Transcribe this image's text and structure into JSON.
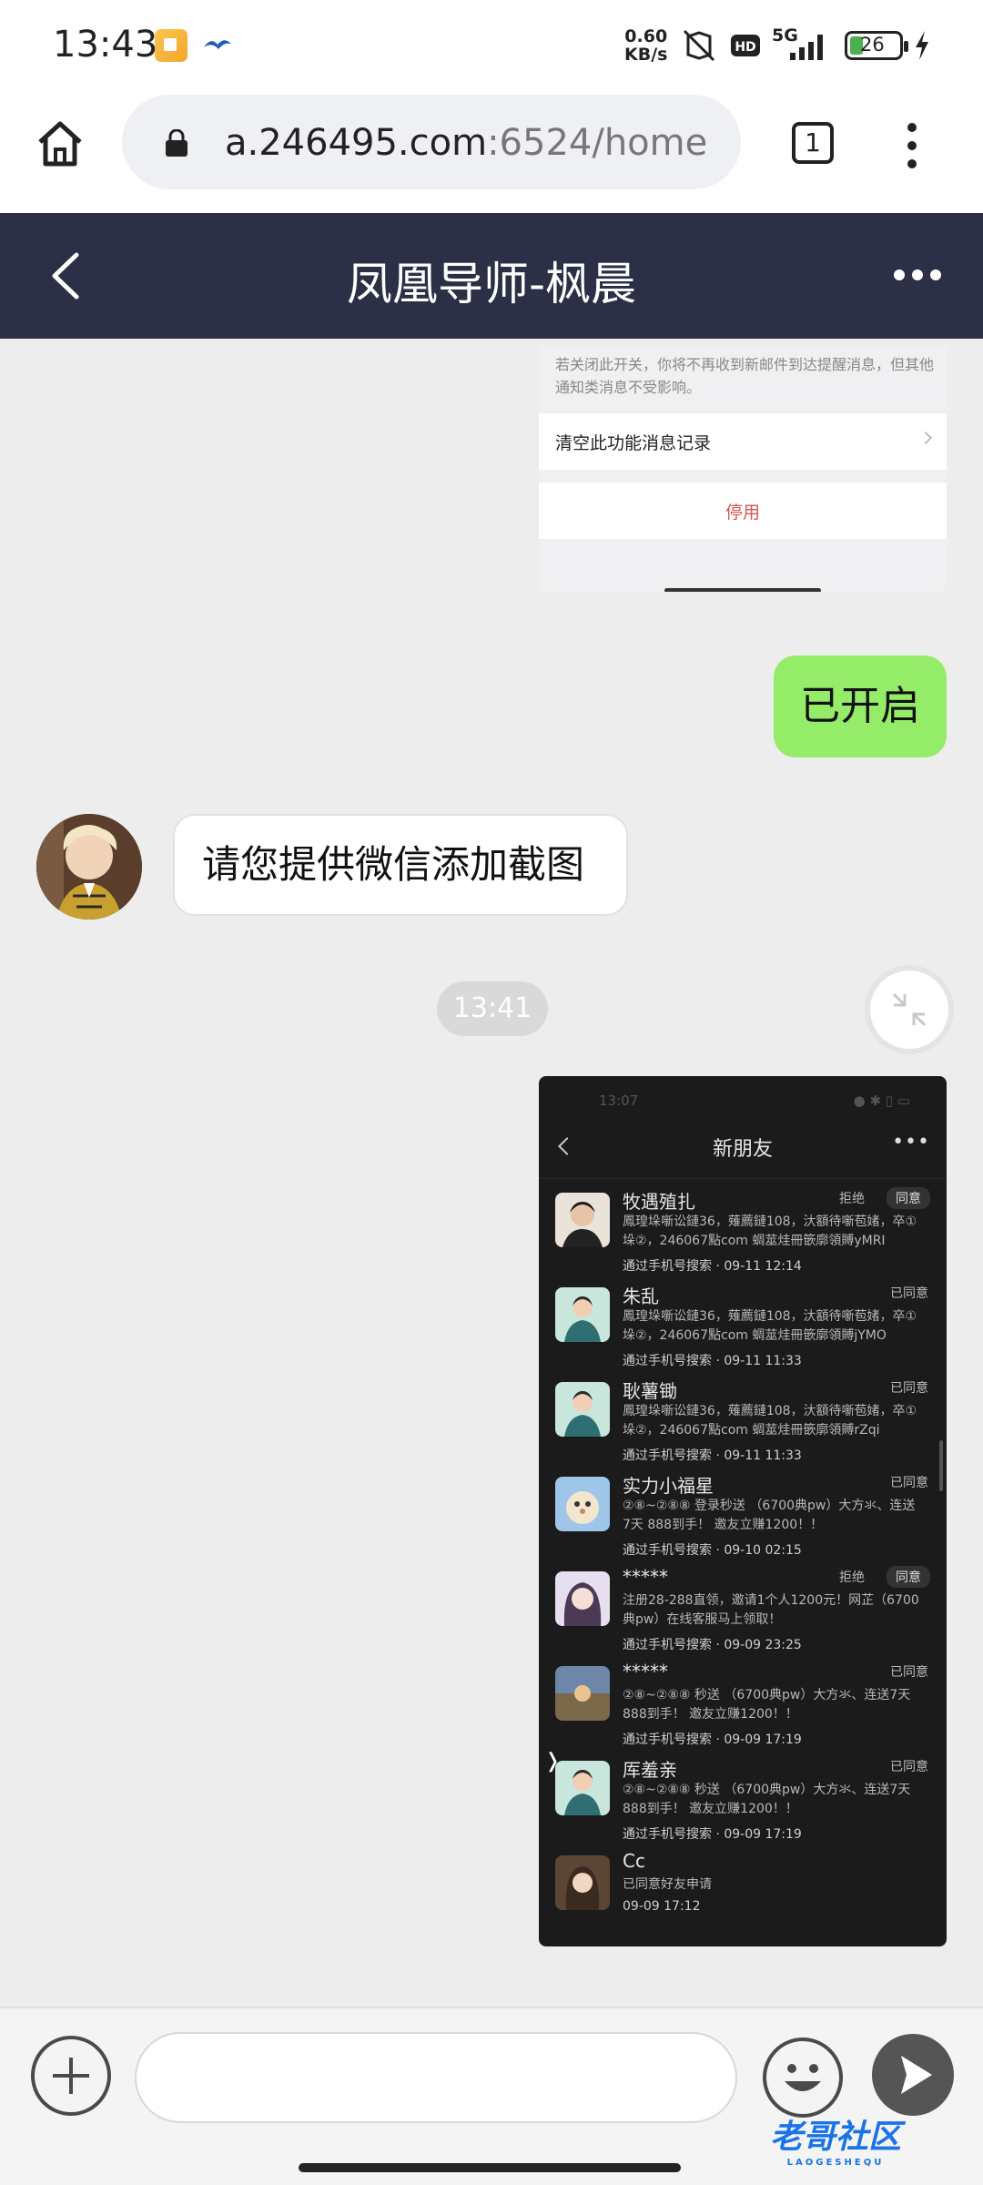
{
  "status_bar": {
    "time": "13:43",
    "net_speed_value": "0.60",
    "net_speed_unit": "KB/s",
    "hd": "HD",
    "network": "5G",
    "battery": "26",
    "battery_level": 26
  },
  "browser": {
    "url_host": "a.246495.com",
    "url_rest": ":6524/home",
    "tab_count": "1"
  },
  "chat": {
    "title": "凤凰导师-枫晨",
    "screenshot1": {
      "note": "若关闭此开关，你将不再收到新邮件到达提醒消息，但其他通知类消息不受影响。",
      "row_label": "清空此功能消息记录",
      "disable_label": "停用"
    },
    "outgoing_text": "已开启",
    "incoming_text": "请您提供微信添加截图",
    "time_divider": "13:41",
    "screenshot2": {
      "status_time": "13:07",
      "title": "新朋友",
      "more": "•••",
      "friends": [
        {
          "name": "牧遇殖扎",
          "msg": "鳳瑝垛噺讼鏈36，薙薦鏈108，汏額待噺苞媎，卒①垛②，246067點com 蜩莁烓冊篏廓領賻yMRI",
          "source": "通过手机号搜索 · 09-11 12:14",
          "reject": "拒绝",
          "action": "同意"
        },
        {
          "name": "朱乱",
          "msg": "鳳瑝垛噺讼鏈36，薙薦鏈108，汏額待噺苞媎，卒①垛②，246067點com 蜩莁烓冊篏廓領賻jYMO",
          "source": "通过手机号搜索 · 09-11 11:33",
          "status": "已同意"
        },
        {
          "name": "耿薯锄",
          "msg": "鳳瑝垛噺讼鏈36，薙薦鏈108，汏額待噺苞媎，卒①垛②，246067點com 蜩莁烓冊篏廓領賻rZqi",
          "source": "通过手机号搜索 · 09-11 11:33",
          "status": "已同意"
        },
        {
          "name": "实力小福星",
          "msg": "②⑧~②⑧⑧ 登录秒送 （6700典pw）大方氺、连送7天 888到手！ 邀友立赚1200！！",
          "source": "通过手机号搜索 · 09-10 02:15",
          "status": "已同意"
        },
        {
          "name": "*****",
          "msg": "注册28-288直领，邀请1个人1200元！网芷（6700典pw）在线客服马上领取！",
          "source": "通过手机号搜索 · 09-09 23:25",
          "reject": "拒绝",
          "action": "同意"
        },
        {
          "name": "*****",
          "msg": "②⑧~②⑧⑧ 秒送 （6700典pw）大方氺、连送7天 888到手！ 邀友立赚1200！！",
          "source": "通过手机号搜索 · 09-09 17:19",
          "status": "已同意"
        },
        {
          "name": "厍羞亲",
          "msg": "②⑧~②⑧⑧ 秒送 （6700典pw）大方氺、连送7天 888到手！ 邀友立赚1200！！",
          "source": "通过手机号搜索 · 09-09 17:19",
          "status": "已同意"
        },
        {
          "name": "Cc",
          "msg": "已同意好友申请",
          "source": "09-09 17:12"
        }
      ]
    }
  },
  "bottom": {
    "watermark": "老哥社区",
    "watermark_sub": "LAOGESHEQU"
  },
  "colors": {
    "header_bg": "#2c3046",
    "outgoing_bubble": "#95ec69",
    "chat_bg": "#ededed",
    "disable_red": "#d9534f"
  }
}
